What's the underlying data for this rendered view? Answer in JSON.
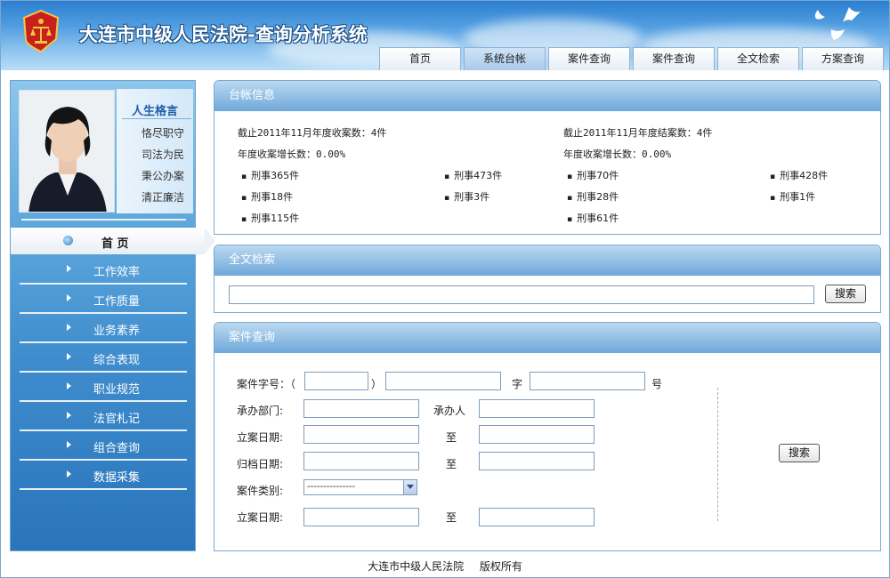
{
  "header": {
    "title": "大连市中级人民法院-查询分析系统",
    "nav": [
      "首页",
      "系统台帐",
      "案件查询",
      "案件查询",
      "全文检索",
      "方案查询"
    ],
    "active_index": 1,
    "colors": {
      "brand": "#2c7fd0"
    }
  },
  "sidebar": {
    "motto_title": "人生格言",
    "mottos": [
      "恪尽职守",
      "司法为民",
      "秉公办案",
      "清正廉洁"
    ],
    "home": "首 页",
    "items": [
      "工作效率",
      "工作质量",
      "业务素养",
      "综合表现",
      "职业规范",
      "法官札记",
      "组合查询",
      "数据采集"
    ]
  },
  "ledger": {
    "title": "台帐信息",
    "received": "截止2011年11月年度收案数：4件",
    "closed": "截止2011年11月年度结案数：4件",
    "received_growth": "年度收案增长数：0.00%",
    "closed_growth": "年度收案增长数：0.00%",
    "list": [
      "刑事365件",
      "刑事473件",
      "刑事70件",
      "刑事428件",
      "刑事18件",
      "刑事3件",
      "刑事28件",
      "刑事1件",
      "刑事115件",
      "刑事61件"
    ]
  },
  "fulltext": {
    "title": "全文检索",
    "search_value": "",
    "search_button": "搜索"
  },
  "casequery": {
    "title": "案件查询",
    "case_no_label": "案件字号：（",
    "paren_close": "）",
    "zi": "字",
    "hao": "号",
    "dept_label": "承办部门:",
    "handler_label": "承办人",
    "filing_date_label": "立案日期:",
    "to": "至",
    "archive_date_label": "归档日期:",
    "category_label": "案件类别:",
    "category_value": "---------------",
    "filing_date_label2": "立案日期:",
    "search_button": "搜索"
  },
  "footer": {
    "org": "大连市中级人民法院",
    "rights": "版权所有"
  }
}
